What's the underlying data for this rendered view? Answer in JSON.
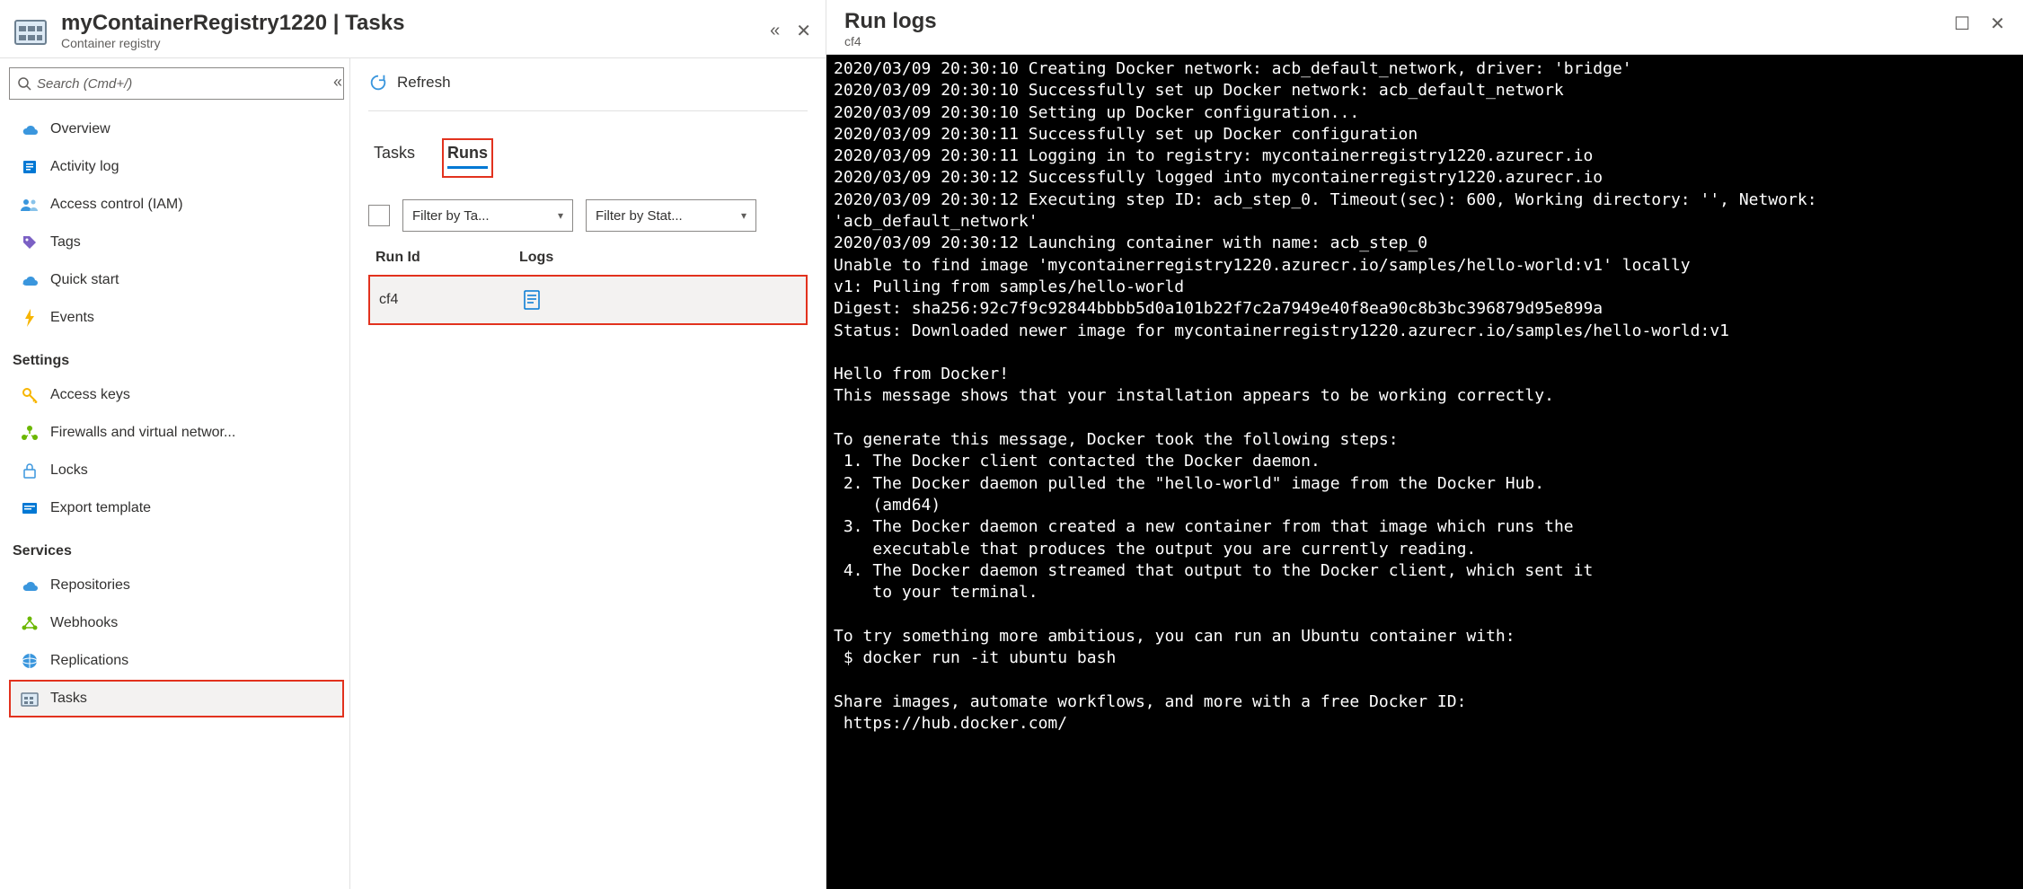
{
  "header": {
    "title": "myContainerRegistry1220 | Tasks",
    "subtitle": "Container registry"
  },
  "sidebar": {
    "search_placeholder": "Search (Cmd+/)",
    "items": [
      {
        "label": "Overview"
      },
      {
        "label": "Activity log"
      },
      {
        "label": "Access control (IAM)"
      },
      {
        "label": "Tags"
      },
      {
        "label": "Quick start"
      },
      {
        "label": "Events"
      }
    ],
    "settings_heading": "Settings",
    "settings": [
      {
        "label": "Access keys"
      },
      {
        "label": "Firewalls and virtual networ..."
      },
      {
        "label": "Locks"
      },
      {
        "label": "Export template"
      }
    ],
    "services_heading": "Services",
    "services": [
      {
        "label": "Repositories"
      },
      {
        "label": "Webhooks"
      },
      {
        "label": "Replications"
      },
      {
        "label": "Tasks"
      }
    ]
  },
  "runs": {
    "refresh_label": "Refresh",
    "tabs": {
      "tasks": "Tasks",
      "runs": "Runs"
    },
    "filter_task": "Filter by Ta...",
    "filter_status": "Filter by Stat...",
    "columns": {
      "run_id": "Run Id",
      "logs": "Logs"
    },
    "rows": [
      {
        "id": "cf4"
      }
    ]
  },
  "logs": {
    "title": "Run logs",
    "subtitle": "cf4",
    "console": "2020/03/09 20:30:10 Creating Docker network: acb_default_network, driver: 'bridge'\n2020/03/09 20:30:10 Successfully set up Docker network: acb_default_network\n2020/03/09 20:30:10 Setting up Docker configuration...\n2020/03/09 20:30:11 Successfully set up Docker configuration\n2020/03/09 20:30:11 Logging in to registry: mycontainerregistry1220.azurecr.io\n2020/03/09 20:30:12 Successfully logged into mycontainerregistry1220.azurecr.io\n2020/03/09 20:30:12 Executing step ID: acb_step_0. Timeout(sec): 600, Working directory: '', Network: 'acb_default_network'\n2020/03/09 20:30:12 Launching container with name: acb_step_0\nUnable to find image 'mycontainerregistry1220.azurecr.io/samples/hello-world:v1' locally\nv1: Pulling from samples/hello-world\nDigest: sha256:92c7f9c92844bbbb5d0a101b22f7c2a7949e40f8ea90c8b3bc396879d95e899a\nStatus: Downloaded newer image for mycontainerregistry1220.azurecr.io/samples/hello-world:v1\n\nHello from Docker!\nThis message shows that your installation appears to be working correctly.\n\nTo generate this message, Docker took the following steps:\n 1. The Docker client contacted the Docker daemon.\n 2. The Docker daemon pulled the \"hello-world\" image from the Docker Hub.\n    (amd64)\n 3. The Docker daemon created a new container from that image which runs the\n    executable that produces the output you are currently reading.\n 4. The Docker daemon streamed that output to the Docker client, which sent it\n    to your terminal.\n\nTo try something more ambitious, you can run an Ubuntu container with:\n $ docker run -it ubuntu bash\n\nShare images, automate workflows, and more with a free Docker ID:\n https://hub.docker.com/"
  }
}
